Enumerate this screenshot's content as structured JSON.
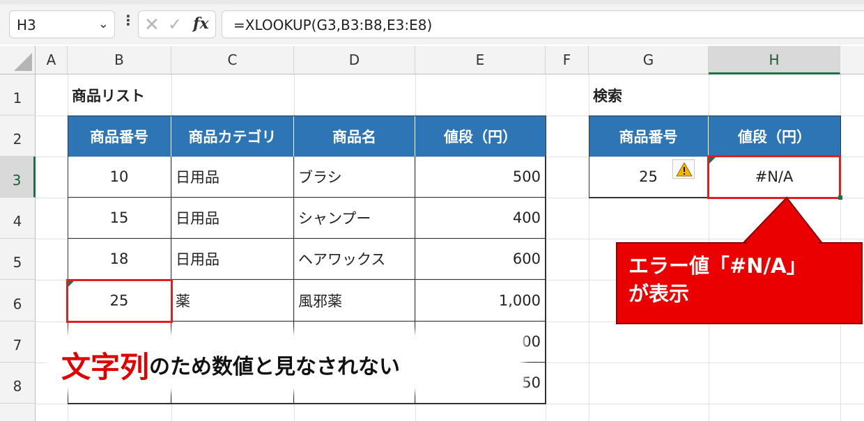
{
  "formula_bar": {
    "name_box": "H3",
    "formula": "=XLOOKUP(G3,B3:B8,E3:E8)",
    "cancel_icon": "cross-icon",
    "enter_icon": "check-icon",
    "fx_label": "fx"
  },
  "columns": [
    "A",
    "B",
    "C",
    "D",
    "E",
    "F",
    "G",
    "H"
  ],
  "rows": [
    "1",
    "2",
    "3",
    "4",
    "5",
    "6",
    "7",
    "8"
  ],
  "selected_cell": "H3",
  "product_table": {
    "title": "商品リスト",
    "headers": [
      "商品番号",
      "商品カテゴリ",
      "商品名",
      "値段（円）"
    ],
    "rows": [
      [
        "10",
        "日用品",
        "ブラシ",
        "500"
      ],
      [
        "15",
        "日用品",
        "シャンプー",
        "400"
      ],
      [
        "18",
        "日用品",
        "ヘアワックス",
        "600"
      ],
      [
        "25",
        "薬",
        "風邪薬",
        "1,000"
      ],
      [
        "",
        "",
        "",
        "00"
      ],
      [
        "",
        "",
        "",
        "50"
      ]
    ]
  },
  "search_table": {
    "title": "検索",
    "headers": [
      "商品番号",
      "値段（円）"
    ],
    "value": "25",
    "result": "#N/A"
  },
  "callout_right": {
    "line1": "エラー値「#N/A」",
    "line2": "が表示"
  },
  "callout_bottom": {
    "highlight": "文字列",
    "rest": "のため数値と見なされない"
  },
  "colors": {
    "header_blue": "#2e75b6",
    "callout_red": "#ea0000",
    "excel_green": "#1e7145"
  }
}
